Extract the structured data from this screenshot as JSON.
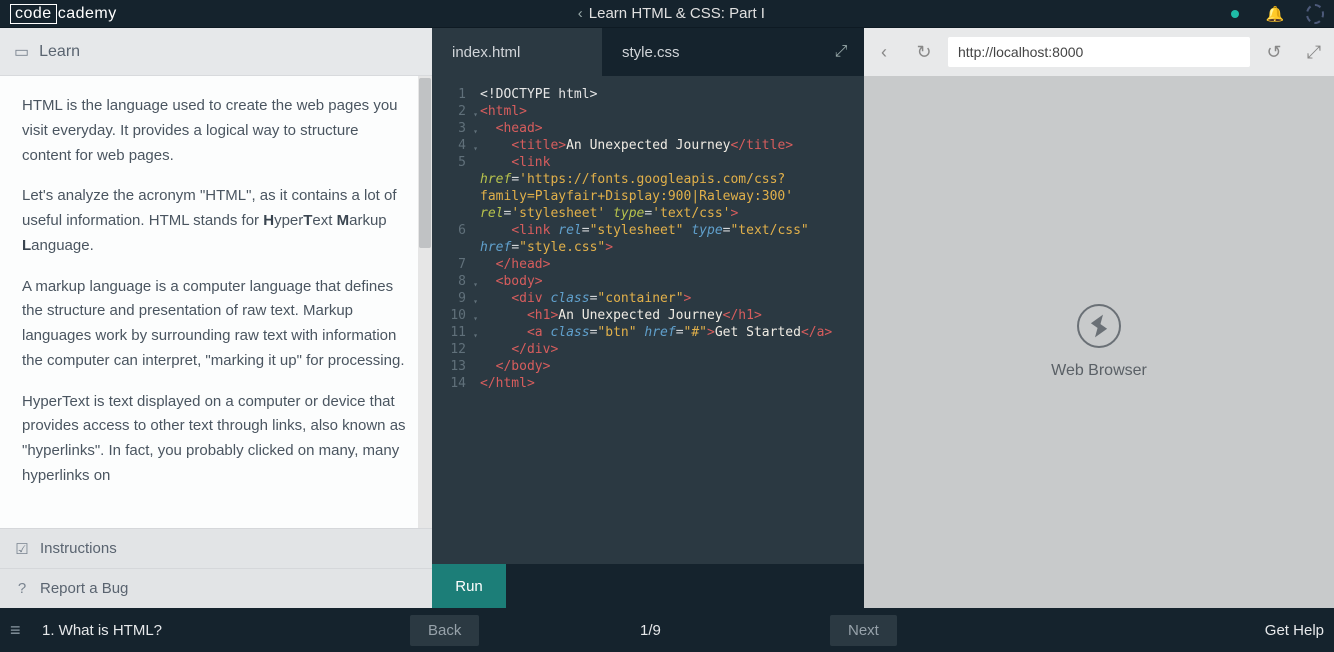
{
  "header": {
    "logo_left": "code",
    "logo_right": "cademy",
    "course_title": "Learn HTML & CSS: Part I"
  },
  "left_panel": {
    "learn_label": "Learn",
    "paragraphs": [
      "HTML is the language used to create the web pages you visit everyday. It provides a logical way to structure content for web pages.",
      "Let's analyze the acronym \"HTML\", as it contains a lot of useful information. HTML stands for ",
      "A markup language is a computer language that defines the structure and presentation of raw text. Markup languages work by surrounding raw text with information the computer can interpret, \"marking it up\" for processing.",
      "HyperText is text displayed on a computer or device that provides access to other text through links, also known as \"hyperlinks\". In fact, you probably clicked on many, many hyperlinks on"
    ],
    "acronym": {
      "h1": "H",
      "w1": "yper",
      "h2": "T",
      "w2": "ext ",
      "h3": "M",
      "w3": "arkup ",
      "h4": "L",
      "w4": "anguage."
    },
    "instructions_label": "Instructions",
    "bug_label": "Report a Bug"
  },
  "editor": {
    "tabs": [
      "index.html",
      "style.css"
    ],
    "lines": [
      {
        "n": 1,
        "f": "",
        "html": "<span class='t-doc'>&lt;!DOCTYPE html&gt;</span>"
      },
      {
        "n": 2,
        "f": "▾",
        "html": "<span class='t-tag'>&lt;html&gt;</span>"
      },
      {
        "n": 3,
        "f": "▾",
        "html": "  <span class='t-tag'>&lt;head&gt;</span>"
      },
      {
        "n": 4,
        "f": "▾",
        "html": "    <span class='t-tag'>&lt;title&gt;</span><span class='t-text'>An Unexpected Journey</span><span class='t-tag'>&lt;/title&gt;</span>"
      },
      {
        "n": 5,
        "f": "",
        "html": "    <span class='t-tag'>&lt;link</span> <span class='t-attr'>href</span>=<span class='t-str'>'https://fonts.googleapis.com/css?family=Playfair+Display:900|Raleway:300'</span> <span class='t-attr'>rel</span>=<span class='t-str'>'stylesheet'</span> <span class='t-attr'>type</span>=<span class='t-str'>'text/css'</span><span class='t-tag'>&gt;</span>"
      },
      {
        "n": 6,
        "f": "",
        "html": "    <span class='t-tag'>&lt;link</span> <span class='t-attr2'>rel</span>=<span class='t-str'>\"stylesheet\"</span> <span class='t-attr2'>type</span>=<span class='t-str'>\"text/css\"</span> <span class='t-attr2'>href</span>=<span class='t-str'>\"style.css\"</span><span class='t-tag'>&gt;</span>"
      },
      {
        "n": 7,
        "f": "",
        "html": "  <span class='t-tag'>&lt;/head&gt;</span>"
      },
      {
        "n": 8,
        "f": "▾",
        "html": "  <span class='t-tag'>&lt;body&gt;</span>"
      },
      {
        "n": 9,
        "f": "▾",
        "html": "    <span class='t-tag'>&lt;div</span> <span class='t-attr2'>class</span>=<span class='t-str'>\"container\"</span><span class='t-tag'>&gt;</span>"
      },
      {
        "n": 10,
        "f": "▾",
        "html": "      <span class='t-tag'>&lt;h1&gt;</span><span class='t-text'>An Unexpected Journey</span><span class='t-tag'>&lt;/h1&gt;</span>"
      },
      {
        "n": 11,
        "f": "▾",
        "html": "      <span class='t-tag'>&lt;a</span> <span class='t-attr2'>class</span>=<span class='t-str'>\"btn\"</span> <span class='t-attr2'>href</span>=<span class='t-str'>\"#\"</span><span class='t-tag'>&gt;</span><span class='t-text'>Get Started</span><span class='t-tag'>&lt;/a&gt;</span>"
      },
      {
        "n": 12,
        "f": "",
        "html": "    <span class='t-tag'>&lt;/div&gt;</span>"
      },
      {
        "n": 13,
        "f": "",
        "html": "  <span class='t-tag'>&lt;/body&gt;</span>"
      },
      {
        "n": 14,
        "f": "",
        "html": "<span class='t-tag'>&lt;/html&gt;</span>"
      }
    ],
    "run_label": "Run"
  },
  "preview": {
    "url": "http://localhost:8000",
    "placeholder": "Web Browser"
  },
  "footer": {
    "lesson": "1. What is HTML?",
    "back": "Back",
    "counter": "1/9",
    "next": "Next",
    "help": "Get Help"
  }
}
